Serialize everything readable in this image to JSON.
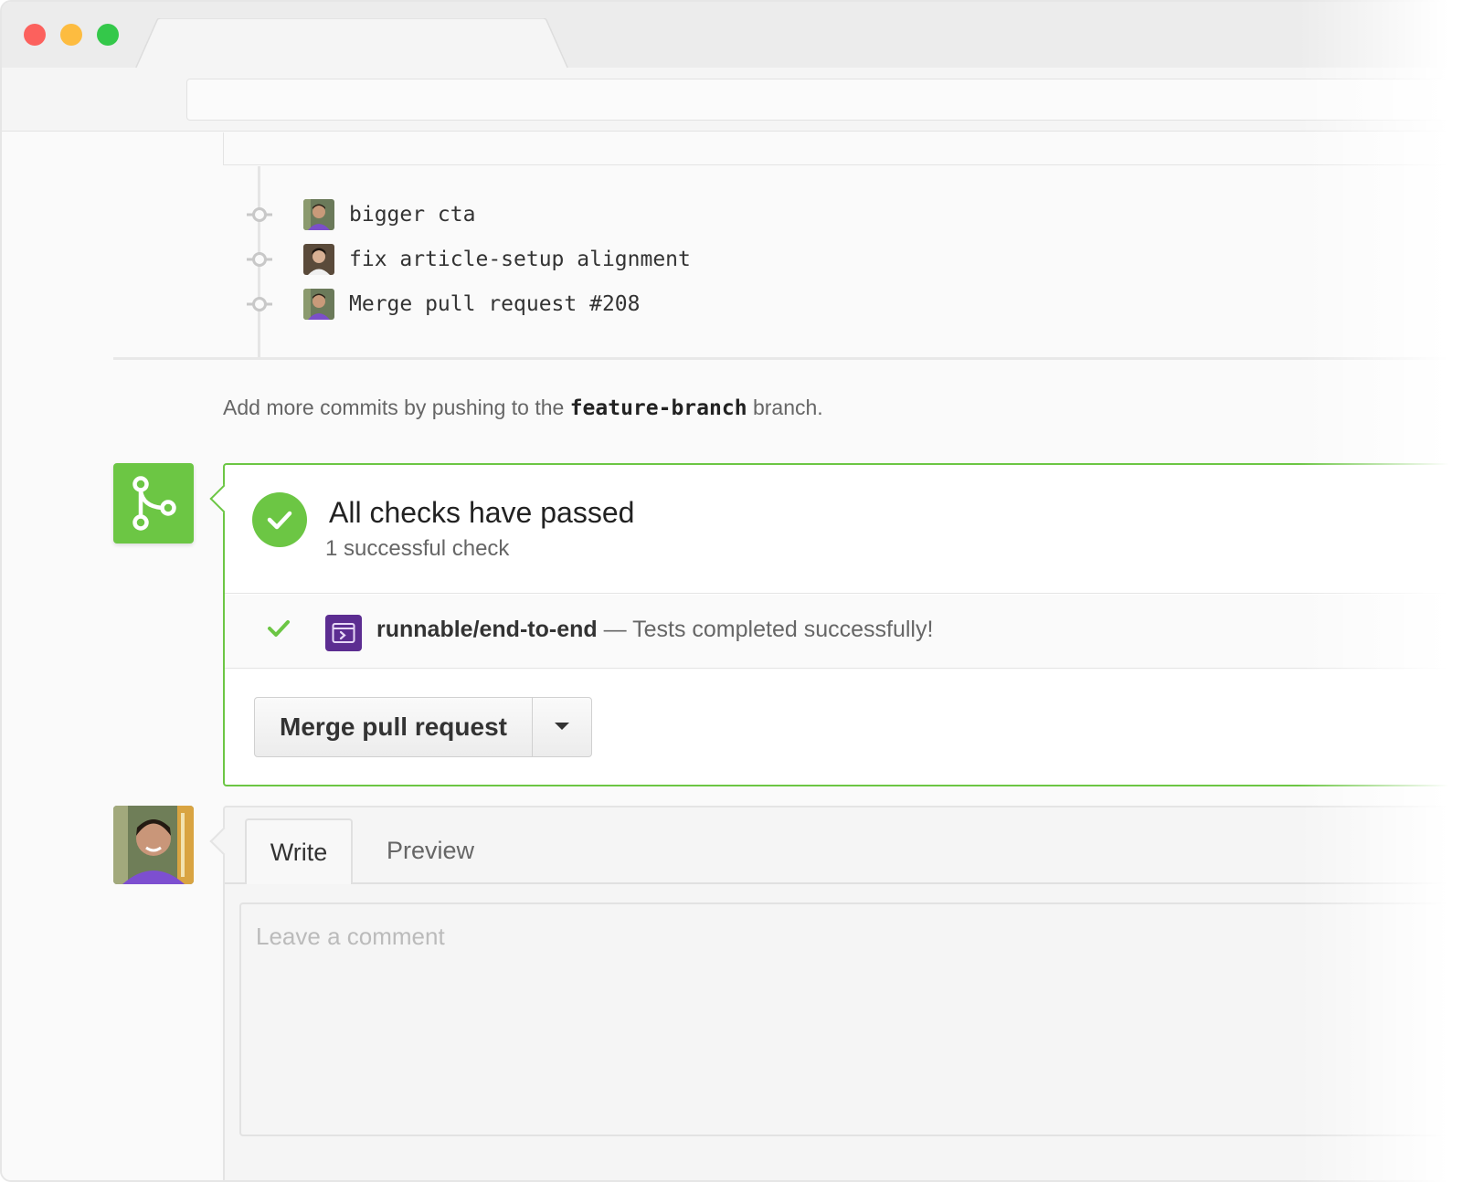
{
  "window": {
    "traffic_lights": [
      "close",
      "minimize",
      "zoom"
    ],
    "colors": {
      "close": "#fc615d",
      "minimize": "#fdbc40",
      "zoom": "#34c84a"
    }
  },
  "commits": [
    {
      "message": "bigger cta",
      "icon": "git-commit-icon"
    },
    {
      "message": "fix article-setup alignment",
      "icon": "git-commit-icon"
    },
    {
      "message": "Merge pull request #208",
      "icon": "git-commit-icon"
    }
  ],
  "branch_note": {
    "prefix": "Add more commits by pushing to the",
    "branch": "feature-branch",
    "suffix": "branch."
  },
  "merge_panel": {
    "status_icon": "check-circle-icon",
    "title": "All checks have passed",
    "subtitle": "1 successful check",
    "check": {
      "context": "runnable/end-to-end",
      "separator": "—",
      "description": "Tests completed successfully!"
    },
    "merge_button": "Merge pull request",
    "accent_color": "#6cc644"
  },
  "comment": {
    "tabs": [
      "Write",
      "Preview"
    ],
    "active_tab": "Write",
    "placeholder": "Leave a comment"
  }
}
